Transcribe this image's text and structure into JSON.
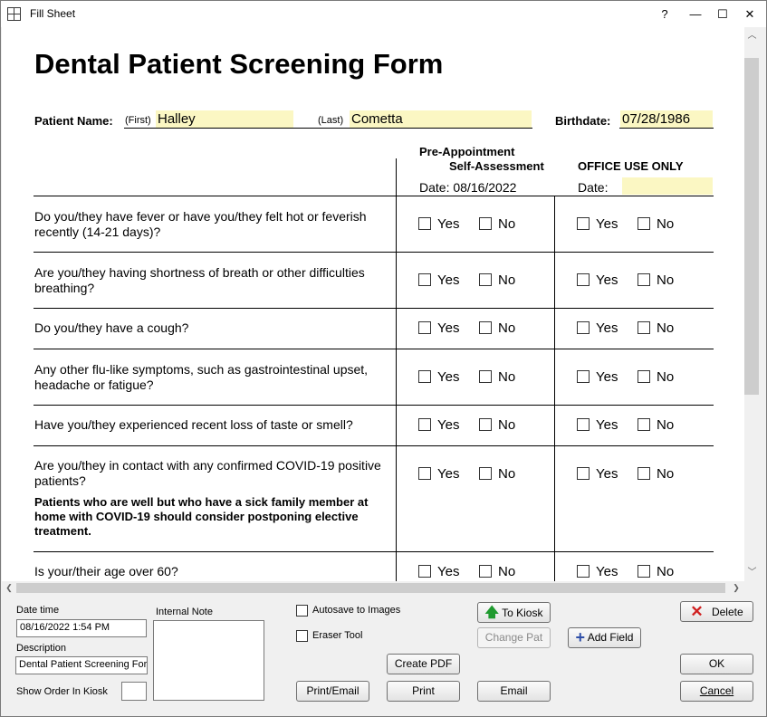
{
  "window": {
    "title": "Fill Sheet",
    "help": "?",
    "minimize": "—",
    "maximize": "☐",
    "close": "✕"
  },
  "form": {
    "title": "Dental Patient Screening Form",
    "patient_name_label": "Patient Name:",
    "first_label": "(First)",
    "first_value": "Halley",
    "last_label": "(Last)",
    "last_value": "Cometta",
    "birthdate_label": "Birthdate:",
    "birthdate_value": "07/28/1986",
    "pre_appt_line1": "Pre-Appointment",
    "pre_appt_line2": "Self-Assessment",
    "office_use": "OFFICE USE ONLY",
    "pre_date": "Date: 08/16/2022",
    "office_date_label": "Date:",
    "office_date_value": "",
    "yes": "Yes",
    "no": "No",
    "questions": [
      "Do you/they have fever or have you/they felt hot or feverish recently (14-21 days)?",
      "Are you/they having shortness of breath or other difficulties breathing?",
      "Do you/they have a cough?",
      "Any other flu-like symptoms, such as gastrointestinal upset, headache or fatigue?",
      "Have you/they experienced recent loss of taste or smell?",
      "Are you/they in contact with any confirmed COVID-19 positive patients?",
      "Is your/their age over 60?"
    ],
    "covid_note": "Patients who are well but who have a sick family member at home with COVID-19 should consider postponing elective treatment."
  },
  "bottom": {
    "date_time_label": "Date time",
    "date_time_value": "08/16/2022 1:54 PM",
    "description_label": "Description",
    "description_value": "Dental Patient Screening Form",
    "show_order_label": "Show Order In Kiosk",
    "show_order_value": "",
    "internal_note_label": "Internal Note",
    "internal_note_value": "",
    "autosave_label": "Autosave to Images",
    "eraser_label": "Eraser Tool",
    "to_kiosk": "To Kiosk",
    "change_pat": "Change Pat",
    "add_field": "Add Field",
    "delete": "Delete",
    "create_pdf": "Create PDF",
    "ok": "OK",
    "print_email": "Print/Email",
    "print": "Print",
    "email": "Email",
    "cancel": "Cancel"
  },
  "colors": {
    "field_bg": "#fbf7c3",
    "delete_x": "#d02020",
    "add_plus": "#2f4fa8",
    "kiosk_arrow": "#1f9a2f"
  }
}
